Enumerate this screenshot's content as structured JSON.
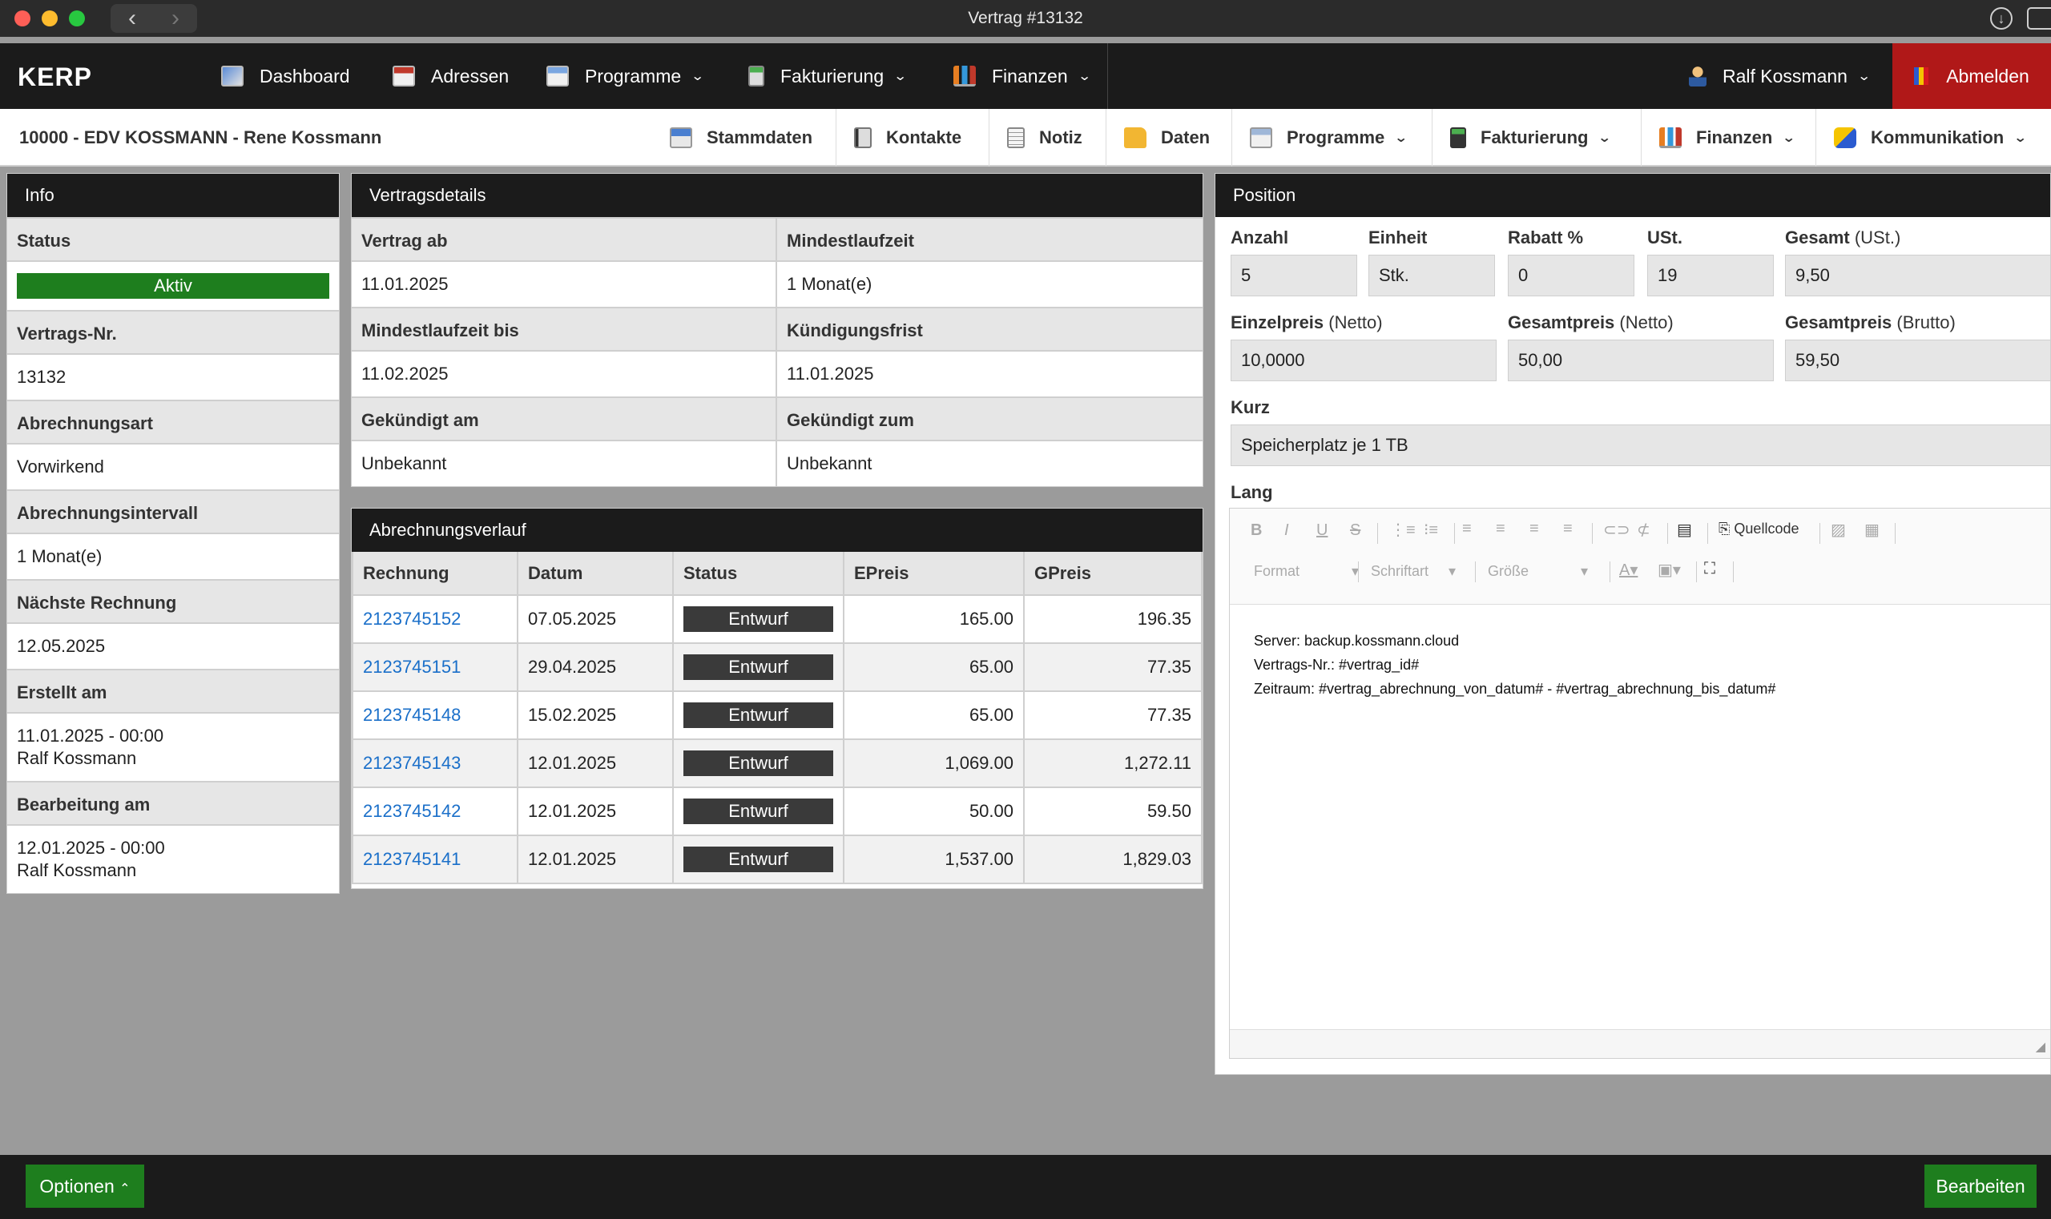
{
  "window": {
    "title": "Vertrag #13132"
  },
  "nav": {
    "logo": "KERP",
    "items": [
      {
        "label": "Dashboard",
        "icon": "dashboard-icon"
      },
      {
        "label": "Adressen",
        "icon": "addresses-icon"
      },
      {
        "label": "Programme",
        "icon": "programs-icon"
      },
      {
        "label": "Fakturierung",
        "icon": "billing-icon"
      },
      {
        "label": "Finanzen",
        "icon": "finance-chart-icon"
      }
    ],
    "user": "Ralf Kossmann",
    "logout": "Abmelden"
  },
  "customer": {
    "name": "10000 - EDV KOSSMANN - Rene Kossmann"
  },
  "subnav": {
    "tabs": [
      {
        "label": "Stammdaten"
      },
      {
        "label": "Kontakte"
      },
      {
        "label": "Notiz"
      },
      {
        "label": "Daten"
      },
      {
        "label": "Programme"
      },
      {
        "label": "Fakturierung"
      },
      {
        "label": "Finanzen"
      },
      {
        "label": "Kommunikation"
      }
    ]
  },
  "info": {
    "title": "Info",
    "status_label": "Status",
    "status_value": "Aktiv",
    "contract_no_label": "Vertrags-Nr.",
    "contract_no": "13132",
    "billing_type_label": "Abrechnungsart",
    "billing_type": "Vorwirkend",
    "billing_interval_label": "Abrechnungsintervall",
    "billing_interval": "1 Monat(e)",
    "next_invoice_label": "Nächste Rechnung",
    "next_invoice": "12.05.2025",
    "created_label": "Erstellt am",
    "created_date": "11.01.2025 - 00:00",
    "created_by": "Ralf Kossmann",
    "edited_label": "Bearbeitung am",
    "edited_date": "12.01.2025 - 00:00",
    "edited_by": "Ralf Kossmann"
  },
  "details": {
    "title": "Vertragsdetails",
    "start_label": "Vertrag ab",
    "start": "11.01.2025",
    "min_term_label": "Mindestlaufzeit",
    "min_term": "1 Monat(e)",
    "min_term_until_label": "Mindestlaufzeit bis",
    "min_term_until": "11.02.2025",
    "notice_label": "Kündigungsfrist",
    "notice": "11.01.2025",
    "cancelled_on_label": "Gekündigt am",
    "cancelled_on": "Unbekannt",
    "cancelled_to_label": "Gekündigt zum",
    "cancelled_to": "Unbekannt"
  },
  "history": {
    "title": "Abrechnungsverlauf",
    "columns": [
      "Rechnung",
      "Datum",
      "Status",
      "EPreis",
      "GPreis"
    ],
    "rows": [
      {
        "invoice": "2123745152",
        "date": "07.05.2025",
        "status": "Entwurf",
        "eprice": "165.00",
        "gprice": "196.35"
      },
      {
        "invoice": "2123745151",
        "date": "29.04.2025",
        "status": "Entwurf",
        "eprice": "65.00",
        "gprice": "77.35"
      },
      {
        "invoice": "2123745148",
        "date": "15.02.2025",
        "status": "Entwurf",
        "eprice": "65.00",
        "gprice": "77.35"
      },
      {
        "invoice": "2123745143",
        "date": "12.01.2025",
        "status": "Entwurf",
        "eprice": "1,069.00",
        "gprice": "1,272.11"
      },
      {
        "invoice": "2123745142",
        "date": "12.01.2025",
        "status": "Entwurf",
        "eprice": "50.00",
        "gprice": "59.50"
      },
      {
        "invoice": "2123745141",
        "date": "12.01.2025",
        "status": "Entwurf",
        "eprice": "1,537.00",
        "gprice": "1,829.03"
      }
    ]
  },
  "position": {
    "title": "Position",
    "qty_label": "Anzahl",
    "qty": "5",
    "unit_label": "Einheit",
    "unit": "Stk.",
    "discount_label": "Rabatt %",
    "discount": "0",
    "vat_label": "USt.",
    "vat": "19",
    "total_label": "Gesamt",
    "total_suffix": "(USt.)",
    "total": "9,50",
    "unit_price_label": "Einzelpreis",
    "unit_price_suffix": "(Netto)",
    "unit_price": "10,0000",
    "net_total_label": "Gesamtpreis",
    "net_total_suffix": "(Netto)",
    "net_total": "50,00",
    "gross_total_label": "Gesamtpreis",
    "gross_total_suffix": "(Brutto)",
    "gross_total": "59,50",
    "short_label": "Kurz",
    "short": "Speicherplatz je 1 TB",
    "long_label": "Lang",
    "editor": {
      "source_label": "Quellcode",
      "format_placeholder": "Format",
      "font_placeholder": "Schriftart",
      "size_placeholder": "Größe",
      "content_lines": [
        "Server: backup.kossmann.cloud",
        "Vertrags-Nr.: #vertrag_id#",
        "Zeitraum: #vertrag_abrechnung_von_datum# - #vertrag_abrechnung_bis_datum#"
      ]
    }
  },
  "footer": {
    "options": "Optionen",
    "edit": "Bearbeiten"
  }
}
